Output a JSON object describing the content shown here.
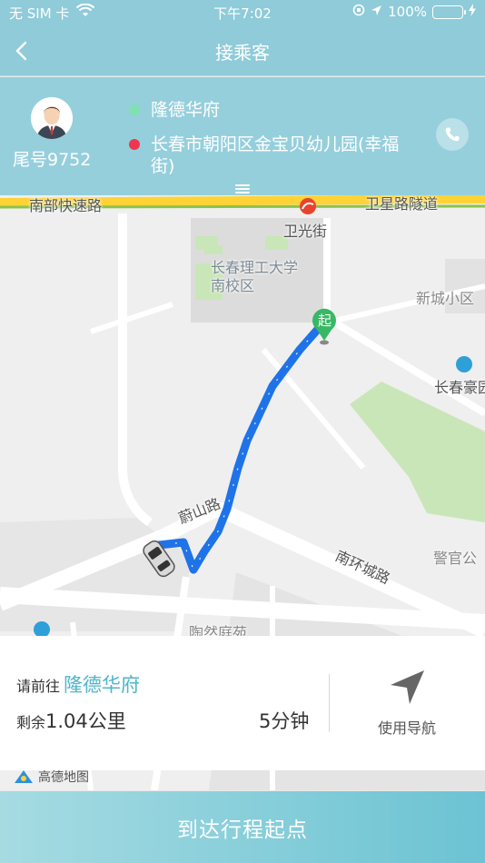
{
  "status": {
    "carrier": "无 SIM 卡",
    "time": "下午7:02",
    "battery": "100%"
  },
  "nav": {
    "title": "接乘客",
    "back_icon": "chevron-left-icon"
  },
  "passenger": {
    "tail_number": "尾号9752",
    "start_name": "隆德华府",
    "end_name": "长春市朝阳区金宝贝幼儿园(幸福街)",
    "start_color": "#7fe0b0",
    "end_color": "#f0364c"
  },
  "map": {
    "labels": {
      "road_nanbu": "南部快速路",
      "road_weixing": "卫星路隧道",
      "weiguang": "卫光街",
      "campus": "长春理工大学南校区",
      "xincheng": "新城小区",
      "changchun_hao": "长春豪园",
      "weishan": "蔚山路",
      "nanhuan": "南环城路",
      "jingguan": "警官公",
      "taoran": "陶然庭苑"
    },
    "start_marker": "起",
    "logo": "高德地图"
  },
  "trip": {
    "goto_label": "请前往",
    "destination": "隆德华府",
    "remaining_label": "剩余",
    "remaining_distance": "1.04公里",
    "eta": "5分钟",
    "navigate_label": "使用导航"
  },
  "action": {
    "arrive_label": "到达行程起点"
  },
  "colors": {
    "header": "#8fcbd9",
    "accent": "#4fb6c9",
    "route": "#1f73e8"
  }
}
